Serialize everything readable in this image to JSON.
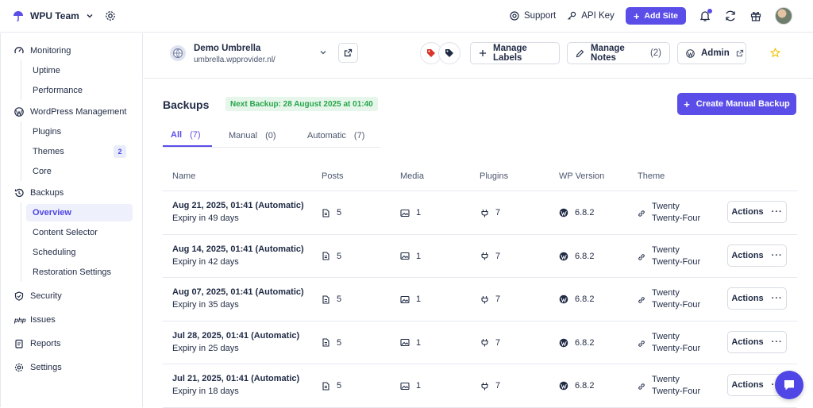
{
  "topbar": {
    "team_name": "WPU Team",
    "support_label": "Support",
    "api_key_label": "API Key",
    "add_site_label": "Add Site"
  },
  "sidebar": {
    "monitoring": "Monitoring",
    "uptime": "Uptime",
    "performance": "Performance",
    "wordpress_management": "WordPress Management",
    "plugins": "Plugins",
    "themes": "Themes",
    "themes_badge": "2",
    "core": "Core",
    "backups": "Backups",
    "overview": "Overview",
    "content_selector": "Content Selector",
    "scheduling": "Scheduling",
    "restoration_settings": "Restoration Settings",
    "security": "Security",
    "issues": "Issues",
    "issues_icon_text": "php",
    "reports": "Reports",
    "settings": "Settings"
  },
  "site": {
    "name": "Demo Umbrella",
    "url": "umbrella.wpprovider.nl/",
    "manage_labels": "Manage Labels",
    "manage_notes": "Manage Notes",
    "notes_count": "(2)",
    "admin": "Admin"
  },
  "backups": {
    "title": "Backups",
    "next_backup": "Next Backup: 28 August 2025 at 01:40",
    "create_button": "Create Manual Backup",
    "tabs": [
      {
        "label": "All",
        "count": "(7)"
      },
      {
        "label": "Manual",
        "count": "(0)"
      },
      {
        "label": "Automatic",
        "count": "(7)"
      }
    ],
    "columns": {
      "name": "Name",
      "posts": "Posts",
      "media": "Media",
      "plugins": "Plugins",
      "wp_version": "WP Version",
      "theme": "Theme"
    },
    "rows": [
      {
        "name": "Aug 21, 2025, 01:41 (Automatic)",
        "expiry": "Expiry in 49 days",
        "posts": "5",
        "media": "1",
        "plugins": "7",
        "wp": "6.8.2",
        "theme_line1": "Twenty",
        "theme_line2": "Twenty-Four",
        "action": "Actions"
      },
      {
        "name": "Aug 14, 2025, 01:41 (Automatic)",
        "expiry": "Expiry in 42 days",
        "posts": "5",
        "media": "1",
        "plugins": "7",
        "wp": "6.8.2",
        "theme_line1": "Twenty",
        "theme_line2": "Twenty-Four",
        "action": "Actions"
      },
      {
        "name": "Aug 07, 2025, 01:41 (Automatic)",
        "expiry": "Expiry in 35 days",
        "posts": "5",
        "media": "1",
        "plugins": "7",
        "wp": "6.8.2",
        "theme_line1": "Twenty",
        "theme_line2": "Twenty-Four",
        "action": "Actions"
      },
      {
        "name": "Jul 28, 2025, 01:41 (Automatic)",
        "expiry": "Expiry in 25 days",
        "posts": "5",
        "media": "1",
        "plugins": "7",
        "wp": "6.8.2",
        "theme_line1": "Twenty",
        "theme_line2": "Twenty-Four",
        "action": "Actions"
      },
      {
        "name": "Jul 21, 2025, 01:41 (Automatic)",
        "expiry": "Expiry in 18 days",
        "posts": "5",
        "media": "1",
        "plugins": "7",
        "wp": "6.8.2",
        "theme_line1": "Twenty",
        "theme_line2": "Twenty-Four",
        "action": "Actions"
      }
    ]
  },
  "colors": {
    "accent": "#5b4ee8",
    "next_backup_bg": "#e6f6ea",
    "next_backup_text": "#26a64a",
    "label_red": "#d9342b",
    "label_dark": "#1f2a44",
    "star": "#f2c200"
  },
  "icons": [
    "umbrella-icon",
    "chevron-down-icon",
    "gear-icon",
    "help-circle-icon",
    "key-icon",
    "bell-icon",
    "refresh-icon",
    "gift-icon",
    "avatar",
    "globe-icon",
    "external-link-icon",
    "tag-icon",
    "plus-icon",
    "pencil-icon",
    "wordpress-icon",
    "star-icon",
    "document-icon",
    "image-icon",
    "plug-icon",
    "link-icon",
    "chat-icon"
  ]
}
